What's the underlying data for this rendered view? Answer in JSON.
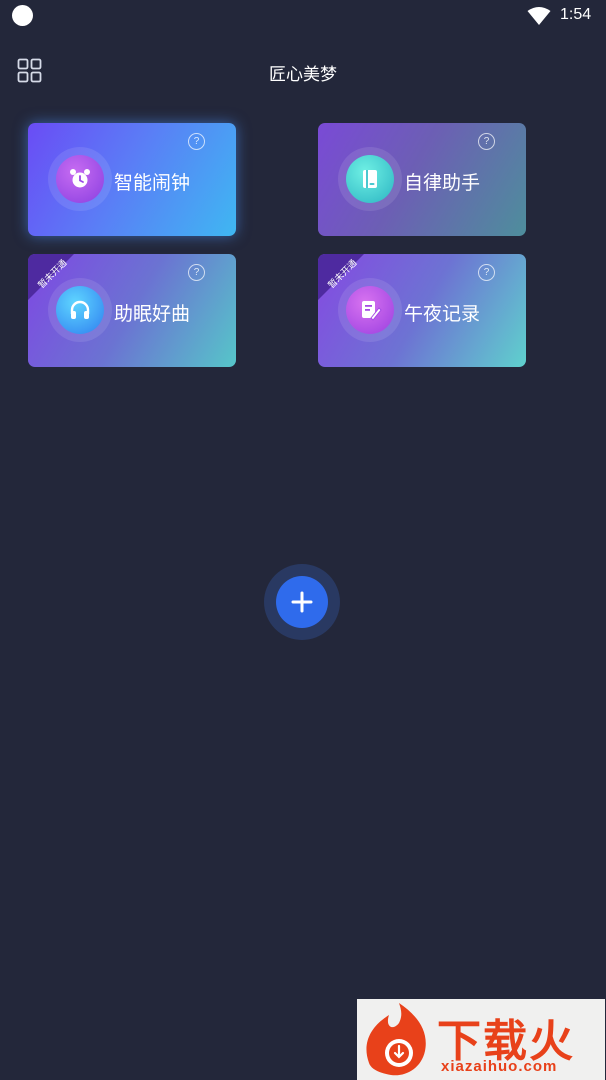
{
  "status_bar": {
    "time": "1:54"
  },
  "header": {
    "title": "匠心美梦"
  },
  "cards": [
    {
      "label": "智能闹钟",
      "help": "?",
      "icon": "alarm-clock-icon",
      "ribbon": ""
    },
    {
      "label": "自律助手",
      "help": "?",
      "icon": "book-icon",
      "ribbon": ""
    },
    {
      "label": "助眠好曲",
      "help": "?",
      "icon": "headphones-icon",
      "ribbon": "暂未开通"
    },
    {
      "label": "午夜记录",
      "help": "?",
      "icon": "note-edit-icon",
      "ribbon": "暂未开通"
    }
  ],
  "fab": {
    "icon": "plus-icon"
  },
  "watermark": {
    "brand": "下载火",
    "url": "xiazaihuo.com"
  },
  "colors": {
    "background": "#23273a",
    "fab": "#2f6bec",
    "ribbon": "#5a2fb0",
    "watermark": "#e8411a"
  }
}
